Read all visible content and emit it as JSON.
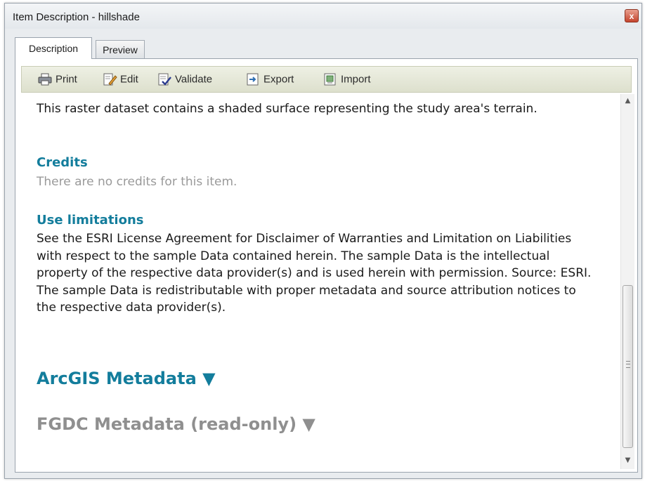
{
  "window": {
    "title": "Item Description - hillshade",
    "close_glyph": "x"
  },
  "tabs": [
    {
      "label": "Description",
      "active": true
    },
    {
      "label": "Preview",
      "active": false
    }
  ],
  "toolbar": {
    "buttons": [
      {
        "label": "Print",
        "icon": "printer-icon"
      },
      {
        "label": "Edit",
        "icon": "edit-icon"
      },
      {
        "label": "Validate",
        "icon": "validate-icon"
      },
      {
        "label": "Export",
        "icon": "export-icon"
      },
      {
        "label": "Import",
        "icon": "import-icon"
      }
    ]
  },
  "content": {
    "summary": "This raster dataset contains a shaded surface representing the study area's terrain.",
    "credits_heading": "Credits",
    "credits_text": "There are no credits for this item.",
    "use_limitations_heading": "Use limitations",
    "use_limitations_text": "See the ESRI License Agreement for Disclaimer of Warranties and Limitation on Liabilities with respect to the sample Data contained herein. The sample Data is the intellectual property of the respective data provider(s) and is used herein with permission. Source: ESRI. The sample Data is redistributable with proper metadata and source attribution notices to the respective data provider(s).",
    "arcgis_metadata": "ArcGIS Metadata ▼",
    "fgdc_metadata": "FGDC Metadata (read-only) ▼"
  },
  "colors": {
    "heading_blue": "#137d9c",
    "muted_gray": "#9a9a9a"
  }
}
